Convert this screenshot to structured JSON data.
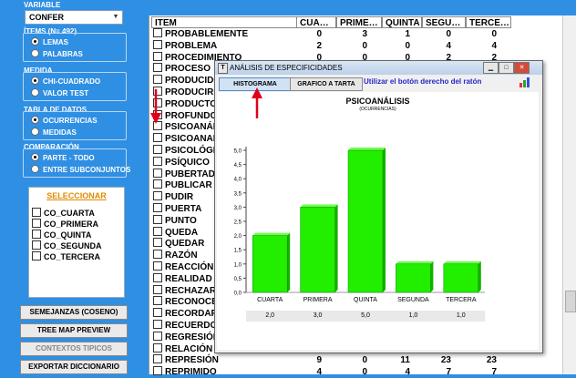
{
  "sidebar": {
    "variable_label": "VARIABLE",
    "variable_value": "CONFER",
    "items_label": "ÍTEMS (N= 492)",
    "items_options": [
      {
        "label": "LEMAS",
        "selected": true
      },
      {
        "label": "PALABRAS",
        "selected": false
      }
    ],
    "medida_label": "MEDIDA",
    "medida_options": [
      {
        "label": "CHI-CUADRADO",
        "selected": true
      },
      {
        "label": "VALOR TEST",
        "selected": false
      }
    ],
    "tabla_label": "TABLA DE DATOS",
    "tabla_options": [
      {
        "label": "OCURRENCIAS",
        "selected": true
      },
      {
        "label": "MEDIDAS",
        "selected": false
      }
    ],
    "comparacion_label": "COMPARACIÓN",
    "comparacion_options": [
      {
        "label": "PARTE - TODO",
        "selected": true
      },
      {
        "label": "ENTRE SUBCONJUNTOS",
        "selected": false
      }
    ],
    "seleccionar_title": "SELECCIONAR",
    "seleccionar_items": [
      "CO_CUARTA",
      "CO_PRIMERA",
      "CO_QUINTA",
      "CO_SEGUNDA",
      "CO_TERCERA"
    ],
    "buttons": {
      "semejanzas": "SEMEJANZAS (COSENO)",
      "treemap": "TREE MAP PREVIEW",
      "contextos": "CONTEXTOS TIPICOS",
      "exportar": "EXPORTAR DICCIONARIO"
    }
  },
  "table": {
    "headers": [
      "ITEM",
      "CUA…",
      "PRIME…",
      "QUINTA",
      "SEGU…",
      "TERCE…"
    ],
    "rows": [
      {
        "item": "PROBABLEMENTE",
        "values": [
          "0",
          "3",
          "1",
          "0",
          "0"
        ]
      },
      {
        "item": "PROBLEMA",
        "values": [
          "2",
          "0",
          "0",
          "4",
          "4"
        ]
      },
      {
        "item": "PROCEDIMIENTO",
        "values": [
          "0",
          "0",
          "0",
          "2",
          "2"
        ]
      },
      {
        "item": "PROCESO",
        "values": []
      },
      {
        "item": "PRODUCIDO",
        "values": []
      },
      {
        "item": "PRODUCIR",
        "values": []
      },
      {
        "item": "PRODUCTO",
        "values": []
      },
      {
        "item": "PROFUNDO",
        "values": []
      },
      {
        "item": "PSICOANÁL",
        "values": []
      },
      {
        "item": "PSICOANAL",
        "values": []
      },
      {
        "item": "PSICOLÓGI",
        "values": []
      },
      {
        "item": "PSÍQUICO",
        "values": []
      },
      {
        "item": "PUBERTAD",
        "values": []
      },
      {
        "item": "PUBLICAR",
        "values": []
      },
      {
        "item": "PUDIR",
        "values": []
      },
      {
        "item": "PUERTA",
        "values": []
      },
      {
        "item": "PUNTO",
        "values": []
      },
      {
        "item": "QUEDA",
        "values": []
      },
      {
        "item": "QUEDAR",
        "values": []
      },
      {
        "item": "RAZÓN",
        "values": []
      },
      {
        "item": "REACCIÓN",
        "values": []
      },
      {
        "item": "REALIDAD",
        "values": []
      },
      {
        "item": "RECHAZAR",
        "values": []
      },
      {
        "item": "RECONOCE",
        "values": []
      },
      {
        "item": "RECORDAR",
        "values": []
      },
      {
        "item": "RECUERDO",
        "values": []
      },
      {
        "item": "REGRESIÓN",
        "values": []
      },
      {
        "item": "RELACIÓN",
        "values": []
      },
      {
        "item": "REPRESIÓN",
        "values": [
          "9",
          "0",
          "11",
          "23",
          "23"
        ]
      },
      {
        "item": "REPRIMIDO",
        "values": [
          "4",
          "0",
          "4",
          "7",
          "7"
        ]
      }
    ]
  },
  "dialog": {
    "title": "ANÁLISIS DE ESPECIFICIDADES",
    "btn_histograma": "HISTOGRAMA",
    "btn_tarta": "GRAFICO A TARTA",
    "hint": "Utilizar el botón derecho del ratón",
    "window_controls": [
      "minimize",
      "maximize",
      "close"
    ]
  },
  "chart_data": {
    "type": "bar",
    "title": "PSICOANÁLISIS",
    "subtitle": "(OCURRENCIAS)",
    "categories": [
      "CUARTA",
      "PRIMERA",
      "QUINTA",
      "SEGUNDA",
      "TERCERA"
    ],
    "values": [
      2.0,
      3.0,
      5.0,
      1.0,
      1.0
    ],
    "value_labels": [
      "2,0",
      "3,0",
      "5,0",
      "1,0",
      "1,0"
    ],
    "yticks": [
      "0,0",
      "0,5",
      "1,0",
      "1,5",
      "2,0",
      "2,5",
      "3,0",
      "3,5",
      "4,0",
      "4,5",
      "5,0"
    ],
    "ylim": [
      0,
      5
    ],
    "bar_color": "#22ee00",
    "grid": false
  },
  "colors": {
    "sidebar_bg": "#2f8fe3",
    "accent_orange": "#e08a00",
    "hint_blue": "#2626c8",
    "arrow_red": "#e0001a"
  }
}
